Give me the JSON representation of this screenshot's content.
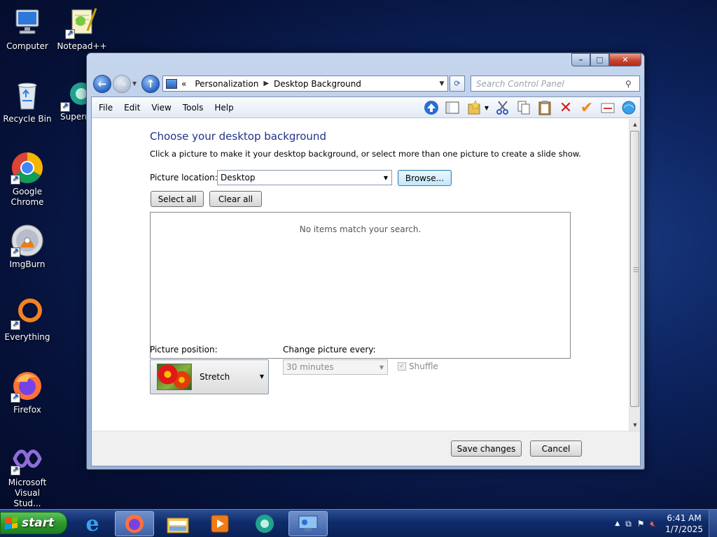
{
  "desktop": {
    "icons": [
      {
        "label": "Computer",
        "icon": "computer-icon"
      },
      {
        "label": "Notepad++",
        "icon": "notepad-plus-plus-icon"
      },
      {
        "label": "Recycle Bin",
        "icon": "recycle-bin-icon"
      },
      {
        "label": "Superm",
        "icon": "supermium-icon"
      },
      {
        "label": "Google Chrome",
        "icon": "chrome-icon"
      },
      {
        "label": "ImgBurn",
        "icon": "imgburn-icon"
      },
      {
        "label": "Everything",
        "icon": "everything-icon"
      },
      {
        "label": "Firefox",
        "icon": "firefox-icon"
      },
      {
        "label": "Microsoft Visual Stud...",
        "icon": "visual-studio-icon"
      }
    ]
  },
  "window": {
    "controls": {
      "minimize": "–",
      "maximize": "□",
      "close": "✕"
    },
    "address": {
      "overflow": "«",
      "crumbs": [
        "Personalization",
        "Desktop Background"
      ]
    },
    "search_placeholder": "Search Control Panel",
    "menu": [
      "File",
      "Edit",
      "View",
      "Tools",
      "Help"
    ],
    "toolbar_icons": [
      "up-arrow-icon",
      "pane-icon",
      "favorites-folder-icon",
      "cut-icon",
      "copy-icon",
      "paste-icon",
      "delete-icon",
      "check-icon",
      "properties-icon",
      "globe-icon"
    ]
  },
  "page": {
    "heading": "Choose your desktop background",
    "subtext": "Click a picture to make it your desktop background, or select more than one picture to create a slide show.",
    "picture_location_label": "Picture location:",
    "picture_location_value": "Desktop",
    "browse_label": "Browse...",
    "select_all_label": "Select all",
    "clear_all_label": "Clear all",
    "empty_message": "No items match your search.",
    "picture_position_label": "Picture position:",
    "picture_position_value": "Stretch",
    "change_picture_label": "Change picture every:",
    "change_picture_value": "30 minutes",
    "shuffle_label": "Shuffle",
    "shuffle_checked": true,
    "save_label": "Save changes",
    "cancel_label": "Cancel"
  },
  "taskbar": {
    "start_label": "start",
    "apps": [
      "internet-explorer-icon",
      "firefox-icon",
      "explorer-icon",
      "media-player-icon",
      "supermium-icon",
      "control-panel-icon"
    ],
    "time": "6:41 AM",
    "date": "1/7/2025"
  }
}
